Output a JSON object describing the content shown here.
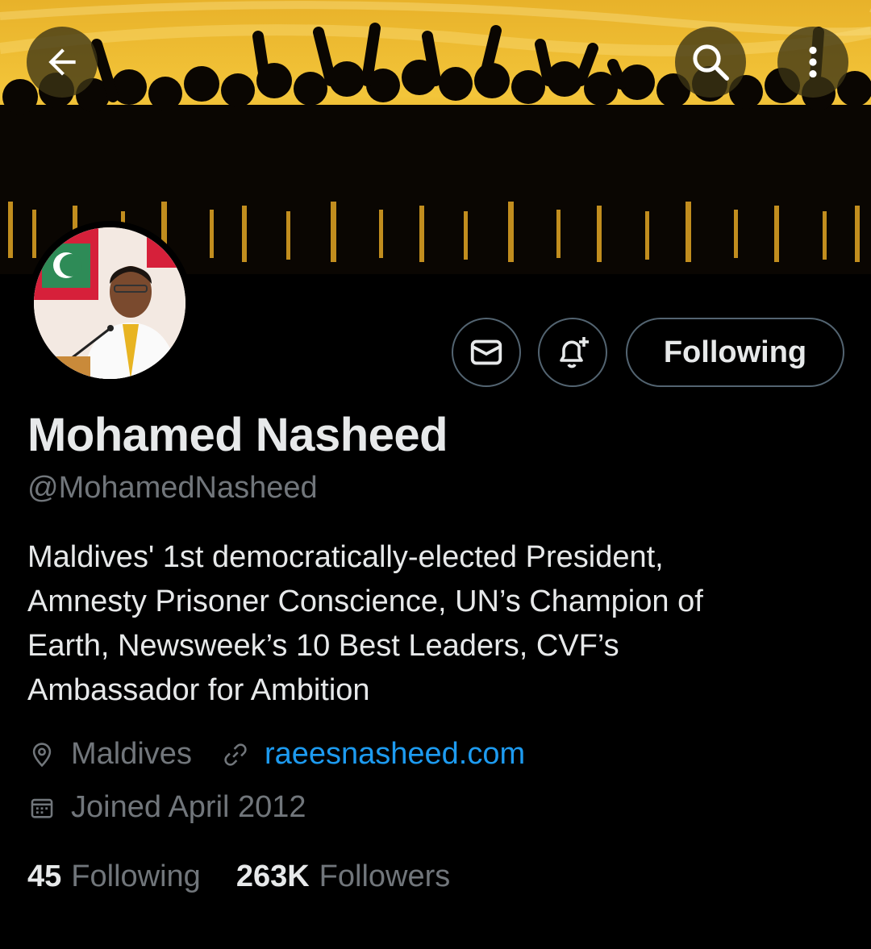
{
  "header": {
    "back_icon": "arrow-left-icon",
    "search_icon": "search-icon",
    "more_icon": "more-vertical-icon"
  },
  "profile": {
    "name": "Mohamed Nasheed",
    "handle": "@MohamedNasheed",
    "bio": "Maldives' 1st democratically-elected President, Amnesty Prisoner Conscience, UN’s Champion of Earth, Newsweek’s 10 Best Leaders, CVF’s Ambassador for Ambition",
    "location": "Maldives",
    "website": "raeesnasheed.com",
    "joined": "Joined April 2012"
  },
  "actions": {
    "message_icon": "mail-icon",
    "notify_icon": "bell-plus-icon",
    "follow_label": "Following"
  },
  "stats": {
    "following_count": "45",
    "following_label": "Following",
    "followers_count": "263K",
    "followers_label": "Followers"
  },
  "colors": {
    "background": "#000000",
    "text_primary": "#e7e9ea",
    "text_secondary": "#71767b",
    "link": "#1d9bf0",
    "border": "#536471",
    "banner_accent": "#f3c53a"
  }
}
